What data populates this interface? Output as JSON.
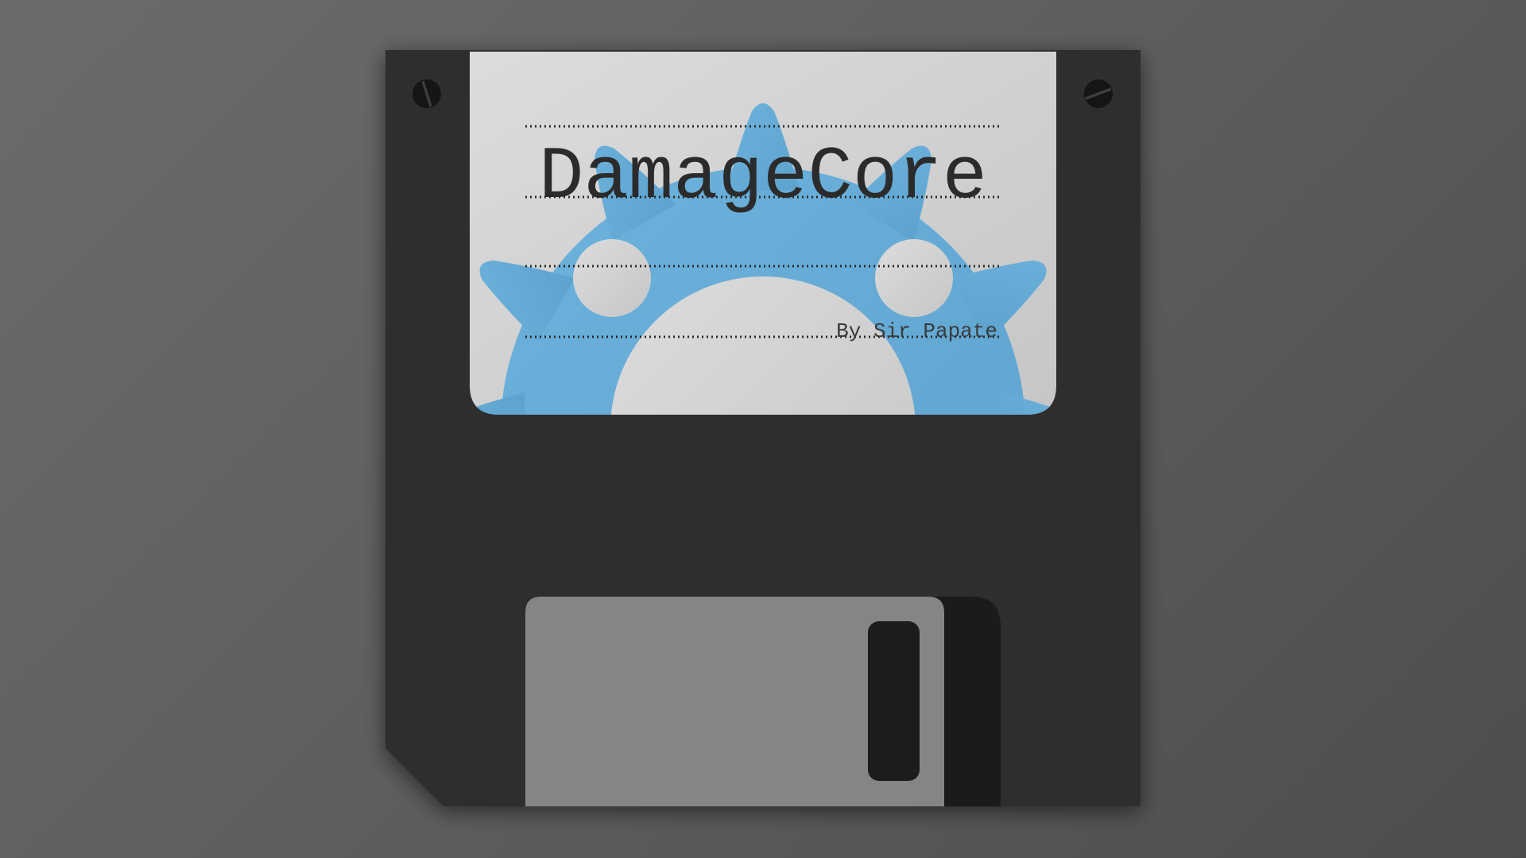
{
  "label": {
    "title": "DamageCore",
    "author": "By Sir Papate"
  },
  "colors": {
    "background": "#5f5f5f",
    "disk_body": "#2d2d2d",
    "label_paper": "#d3d3d3",
    "gear": "#64abd6",
    "shutter": "#858585",
    "shutter_slot": "#1c1c1c",
    "text": "#2b2b2b"
  },
  "icons": {
    "disk": "floppy-disk-icon",
    "gear": "gear-logo",
    "screw": "screw-icon"
  }
}
